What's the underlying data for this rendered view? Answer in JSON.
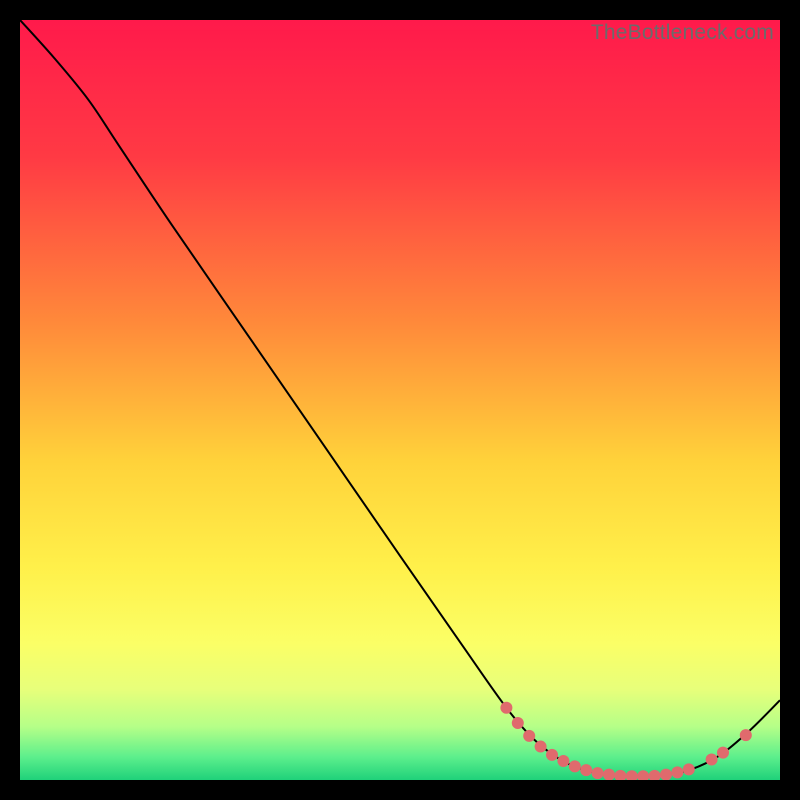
{
  "watermark": "TheBottleneck.com",
  "chart_data": {
    "type": "line",
    "title": "",
    "xlabel": "",
    "ylabel": "",
    "xlim": [
      0,
      100
    ],
    "ylim": [
      0,
      100
    ],
    "gradient_stops": [
      {
        "offset": 0,
        "color": "#ff1a4b"
      },
      {
        "offset": 18,
        "color": "#ff3a44"
      },
      {
        "offset": 40,
        "color": "#ff8a3a"
      },
      {
        "offset": 58,
        "color": "#ffd23a"
      },
      {
        "offset": 72,
        "color": "#fff04a"
      },
      {
        "offset": 82,
        "color": "#fbff66"
      },
      {
        "offset": 88,
        "color": "#e8ff7a"
      },
      {
        "offset": 93,
        "color": "#b5ff88"
      },
      {
        "offset": 97,
        "color": "#5cef8c"
      },
      {
        "offset": 100,
        "color": "#1fd17a"
      }
    ],
    "series": [
      {
        "name": "bottleneck-curve",
        "points": [
          {
            "x": 0.0,
            "y": 100.0
          },
          {
            "x": 4.5,
            "y": 95.0
          },
          {
            "x": 9.0,
            "y": 89.5
          },
          {
            "x": 13.0,
            "y": 83.5
          },
          {
            "x": 20.0,
            "y": 73.0
          },
          {
            "x": 30.0,
            "y": 58.5
          },
          {
            "x": 40.0,
            "y": 44.0
          },
          {
            "x": 50.0,
            "y": 29.5
          },
          {
            "x": 58.0,
            "y": 18.0
          },
          {
            "x": 64.0,
            "y": 9.5
          },
          {
            "x": 68.0,
            "y": 5.0
          },
          {
            "x": 72.0,
            "y": 2.2
          },
          {
            "x": 76.0,
            "y": 0.9
          },
          {
            "x": 80.0,
            "y": 0.5
          },
          {
            "x": 84.0,
            "y": 0.6
          },
          {
            "x": 88.0,
            "y": 1.3
          },
          {
            "x": 92.0,
            "y": 3.2
          },
          {
            "x": 96.0,
            "y": 6.5
          },
          {
            "x": 100.0,
            "y": 10.5
          }
        ]
      }
    ],
    "markers": [
      {
        "x": 64.0,
        "y": 9.5
      },
      {
        "x": 65.5,
        "y": 7.5
      },
      {
        "x": 67.0,
        "y": 5.8
      },
      {
        "x": 68.5,
        "y": 4.4
      },
      {
        "x": 70.0,
        "y": 3.3
      },
      {
        "x": 71.5,
        "y": 2.5
      },
      {
        "x": 73.0,
        "y": 1.8
      },
      {
        "x": 74.5,
        "y": 1.3
      },
      {
        "x": 76.0,
        "y": 0.9
      },
      {
        "x": 77.5,
        "y": 0.7
      },
      {
        "x": 79.0,
        "y": 0.55
      },
      {
        "x": 80.5,
        "y": 0.5
      },
      {
        "x": 82.0,
        "y": 0.5
      },
      {
        "x": 83.5,
        "y": 0.55
      },
      {
        "x": 85.0,
        "y": 0.7
      },
      {
        "x": 86.5,
        "y": 1.0
      },
      {
        "x": 88.0,
        "y": 1.4
      },
      {
        "x": 91.0,
        "y": 2.7
      },
      {
        "x": 92.5,
        "y": 3.6
      },
      {
        "x": 95.5,
        "y": 5.9
      }
    ],
    "marker_color": "#e06a6d",
    "line_color": "#000000"
  }
}
